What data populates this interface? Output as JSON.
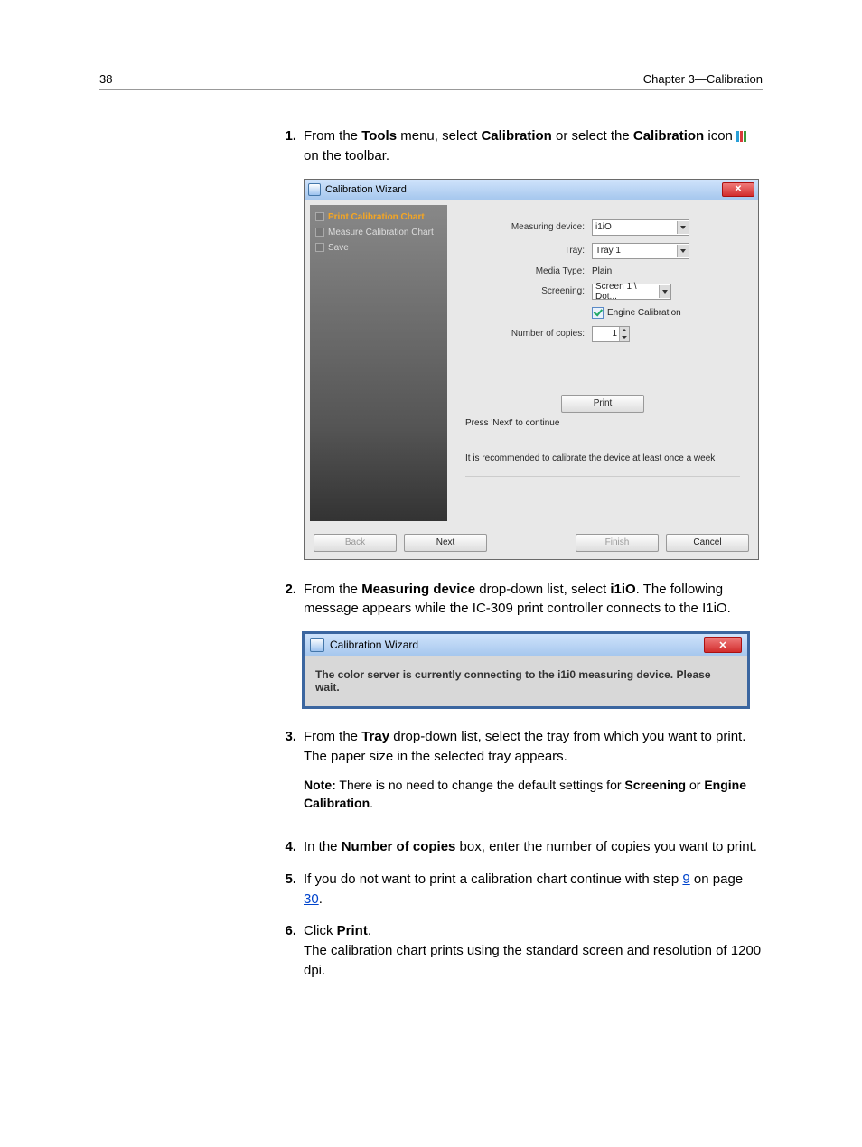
{
  "header": {
    "page_number": "38",
    "chapter": "Chapter 3—Calibration"
  },
  "steps": {
    "s1": {
      "num": "1.",
      "pre": "From the ",
      "tools": "Tools",
      "mid1": " menu, select ",
      "calib": "Calibration",
      "mid2": " or select the ",
      "calibicon": "Calibration",
      "mid3": " icon ",
      "end": " on the toolbar."
    },
    "s2": {
      "num": "2.",
      "pre": "From the ",
      "md": "Measuring device",
      "mid1": " drop-down list, select ",
      "i1io": "i1iO",
      "mid2": ". The following message appears while the IC-309 print controller connects to the I1iO."
    },
    "s3": {
      "num": "3.",
      "pre": "From the ",
      "tray": "Tray",
      "mid1": " drop-down list, select the tray from which you want to print.",
      "line2": "The paper size in the selected tray appears."
    },
    "note": {
      "label": "Note:",
      "t1": " There is no need to change the default settings for ",
      "scr": "Screening",
      "t2": " or ",
      "eng": "Engine Calibration",
      "t3": "."
    },
    "s4": {
      "num": "4.",
      "pre": "In the ",
      "noc": "Number of copies",
      "rest": " box, enter the number of copies you want to print."
    },
    "s5": {
      "num": "5.",
      "t1": "If you do not want to print a calibration chart continue with step ",
      "link9": "9",
      "t2": " on page ",
      "link30": "30",
      "t3": "."
    },
    "s6": {
      "num": "6.",
      "t1": "Click ",
      "print": "Print",
      "t2": ".",
      "line2": "The calibration chart prints using the standard screen and resolution of 1200 dpi."
    }
  },
  "wizard": {
    "title": "Calibration Wizard",
    "sidebar": {
      "item1": "Print Calibration Chart",
      "item2": "Measure Calibration Chart",
      "item3": "Save"
    },
    "form": {
      "measuring_device_label": "Measuring device:",
      "measuring_device_value": "i1iO",
      "tray_label": "Tray:",
      "tray_value": "Tray 1",
      "media_type_label": "Media Type:",
      "media_type_value": "Plain",
      "screening_label": "Screening:",
      "screening_value": "Screen 1 \\ Dot...",
      "engine_cal_label": "Engine Calibration",
      "copies_label": "Number of copies:",
      "copies_value": "1"
    },
    "print_button": "Print",
    "hint": "Press 'Next' to continue",
    "recommend": "It is recommended to calibrate the device at least once a week",
    "footer": {
      "back": "Back",
      "next": "Next",
      "finish": "Finish",
      "cancel": "Cancel"
    }
  },
  "mini_dialog": {
    "title": "Calibration Wizard",
    "message": "The color server is currently connecting to the i1i0 measuring device. Please wait."
  }
}
